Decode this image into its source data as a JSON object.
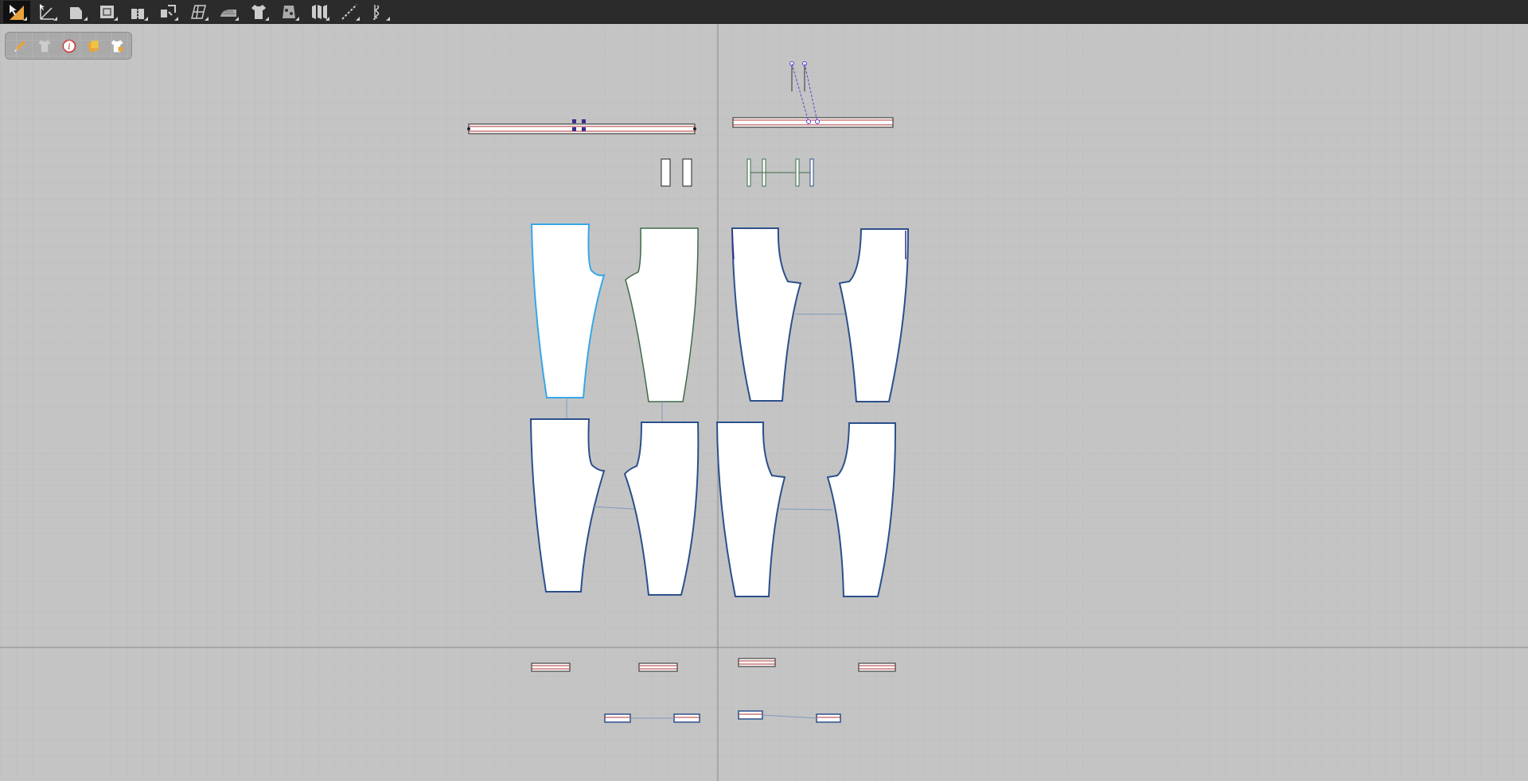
{
  "toolbar": {
    "tools": [
      {
        "name": "select-move-tool",
        "icon": "select-arrow-icon",
        "active": true
      },
      {
        "name": "edit-pattern-tool",
        "icon": "edit-pattern-icon"
      },
      {
        "name": "polygon-tool",
        "icon": "polygon-icon"
      },
      {
        "name": "internal-shape-tool",
        "icon": "internal-shape-icon"
      },
      {
        "name": "sewing-tool",
        "icon": "sewing-icon"
      },
      {
        "name": "segment-sewing-tool",
        "icon": "segment-sewing-icon"
      },
      {
        "name": "grid-tool",
        "icon": "grid-icon"
      },
      {
        "name": "iron-tool",
        "icon": "iron-icon"
      },
      {
        "name": "garment-tool",
        "icon": "shirt-icon"
      },
      {
        "name": "pin-tool",
        "icon": "pin-icon"
      },
      {
        "name": "pleats-tool",
        "icon": "pleats-icon"
      },
      {
        "name": "line-tool",
        "icon": "dashed-line-icon"
      },
      {
        "name": "elastic-tool",
        "icon": "elastic-icon"
      }
    ]
  },
  "floating_bar": {
    "buttons": [
      {
        "name": "pattern-edit-button",
        "icon": "pen-icon"
      },
      {
        "name": "garment-view-button",
        "icon": "shirt-icon"
      },
      {
        "name": "info-button",
        "icon": "info-icon"
      },
      {
        "name": "fabric-button",
        "icon": "fabric-icon"
      },
      {
        "name": "avatar-garment-button",
        "icon": "shirt-lock-icon"
      }
    ]
  },
  "colors": {
    "canvas_bg": "#c4c4c4",
    "grid": "#b7b7b7",
    "axis": "#8a8a8a",
    "selected_outline": "#37a7e8",
    "piece_outline": "#2c4f8c",
    "seam_green": "#3d6b4a",
    "seam_red": "#b03333",
    "sewing_link": "#7d9bbd",
    "pin_purple": "#5a3fd0"
  }
}
